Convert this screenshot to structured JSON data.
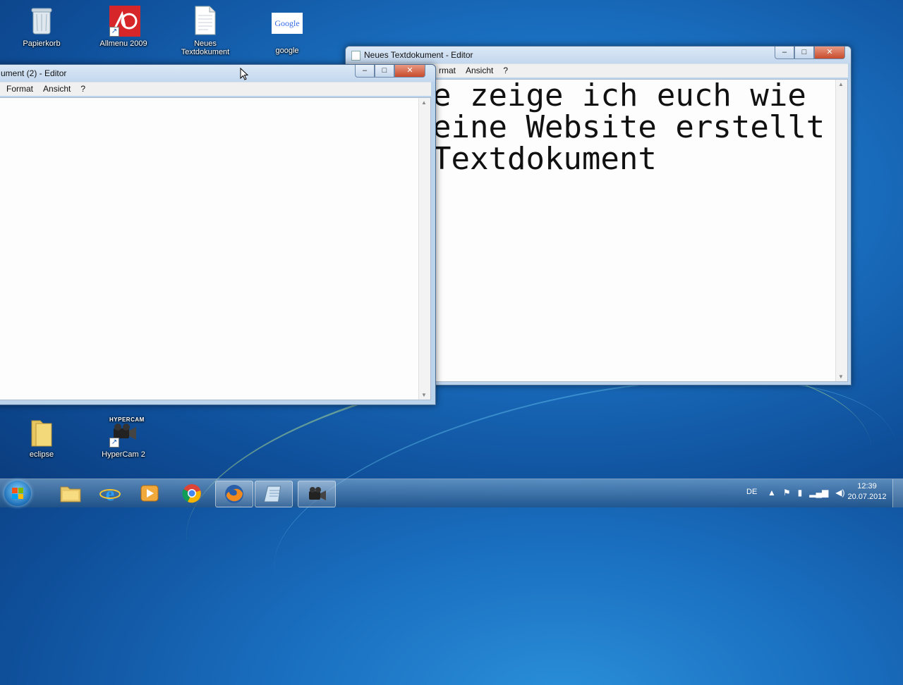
{
  "desktop": {
    "icons": [
      {
        "label": "Papierkorb"
      },
      {
        "label": "Allmenu 2009"
      },
      {
        "label": "Neues Textdokument"
      },
      {
        "label": "google",
        "logo_text": "Google"
      },
      {
        "label": "eclipse"
      },
      {
        "label": "HyperCam 2",
        "logo_text": "HYPERCAM"
      }
    ]
  },
  "window_right": {
    "title": "Neues Textdokument - Editor",
    "menu": [
      "rmat",
      "Ansicht",
      "?"
    ],
    "controls": {
      "minimize": "–",
      "maximize": "□",
      "close": "✕"
    },
    "content": "e zeige ich euch wie\neine Website erstellt\nTextdokument"
  },
  "window_left": {
    "title": "ument (2) - Editor",
    "menu": [
      "Format",
      "Ansicht",
      "?"
    ],
    "controls": {
      "minimize": "–",
      "maximize": "□",
      "close": "✕"
    },
    "content": ""
  },
  "taskbar": {
    "language": "DE",
    "time": "12:39",
    "date": "20.07.2012",
    "apps": [
      "windows-explorer",
      "internet-explorer",
      "media-player",
      "chrome",
      "firefox",
      "notepad",
      "hypercam"
    ]
  },
  "colors": {
    "desktop_blue": "#1a6fc0",
    "close_red": "#c74a2b"
  }
}
